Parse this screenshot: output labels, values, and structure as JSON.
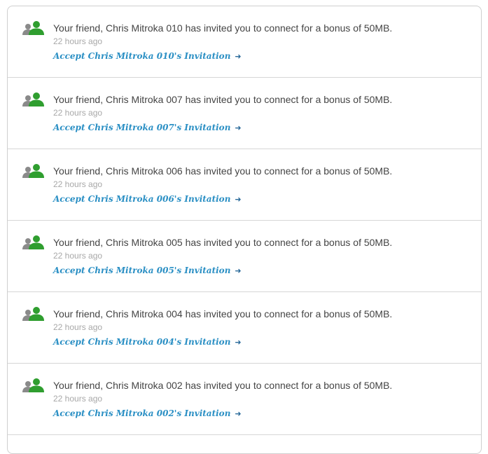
{
  "icons": {
    "avatar": "friend-connect-icon",
    "arrow": "arrow-right-icon",
    "avatar_front_color": "#2f9e2f",
    "avatar_back_color": "#8a8a8a"
  },
  "invitations": [
    {
      "message": "Your friend, Chris Mitroka 010 has invited you to connect for a bonus of 50MB.",
      "time": "22 hours ago",
      "link": "Accept Chris Mitroka 010's Invitation",
      "arrow": "➜"
    },
    {
      "message": "Your friend, Chris Mitroka 007 has invited you to connect for a bonus of 50MB.",
      "time": "22 hours ago",
      "link": "Accept Chris Mitroka 007's Invitation",
      "arrow": "➜"
    },
    {
      "message": "Your friend, Chris Mitroka 006 has invited you to connect for a bonus of 50MB.",
      "time": "22 hours ago",
      "link": "Accept Chris Mitroka 006's Invitation",
      "arrow": "➜"
    },
    {
      "message": "Your friend, Chris Mitroka 005 has invited you to connect for a bonus of 50MB.",
      "time": "22 hours ago",
      "link": "Accept Chris Mitroka 005's Invitation",
      "arrow": "➜"
    },
    {
      "message": "Your friend, Chris Mitroka 004 has invited you to connect for a bonus of 50MB.",
      "time": "22 hours ago",
      "link": "Accept Chris Mitroka 004's Invitation",
      "arrow": "➜"
    },
    {
      "message": "Your friend, Chris Mitroka 002 has invited you to connect for a bonus of 50MB.",
      "time": "22 hours ago",
      "link": "Accept Chris Mitroka 002's Invitation",
      "arrow": "➜"
    }
  ]
}
